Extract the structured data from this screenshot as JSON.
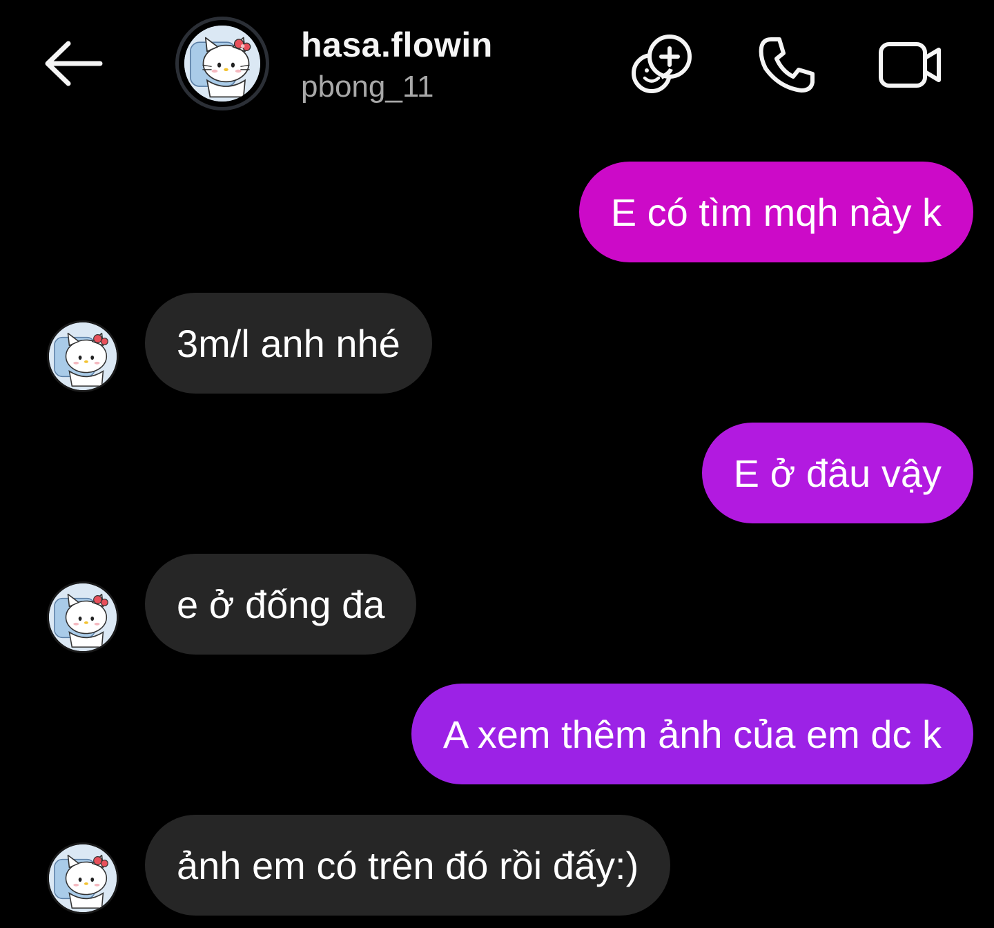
{
  "header": {
    "title": "hasa.flowin",
    "subtitle": "pbong_11",
    "icons": {
      "back": "arrow-left-icon",
      "sticker": "sticker-add-icon",
      "call": "phone-icon",
      "video": "video-camera-icon"
    }
  },
  "colors": {
    "background": "#000000",
    "incoming_bubble": "#262626",
    "outgoing_bubble_1": "#cc0ac8",
    "outgoing_bubble_2": "#b21ae0",
    "outgoing_bubble_3": "#9c22e6"
  },
  "messages": [
    {
      "direction": "outgoing",
      "text": "E có tìm mqh này k"
    },
    {
      "direction": "incoming",
      "text": "3m/l anh nhé"
    },
    {
      "direction": "outgoing",
      "text": "E ở đâu vậy"
    },
    {
      "direction": "incoming",
      "text": "e ở đống đa"
    },
    {
      "direction": "outgoing",
      "text": "A xem thêm ảnh của em dc k"
    },
    {
      "direction": "incoming",
      "text": "ảnh em có trên đó rồi đấy:)"
    }
  ]
}
